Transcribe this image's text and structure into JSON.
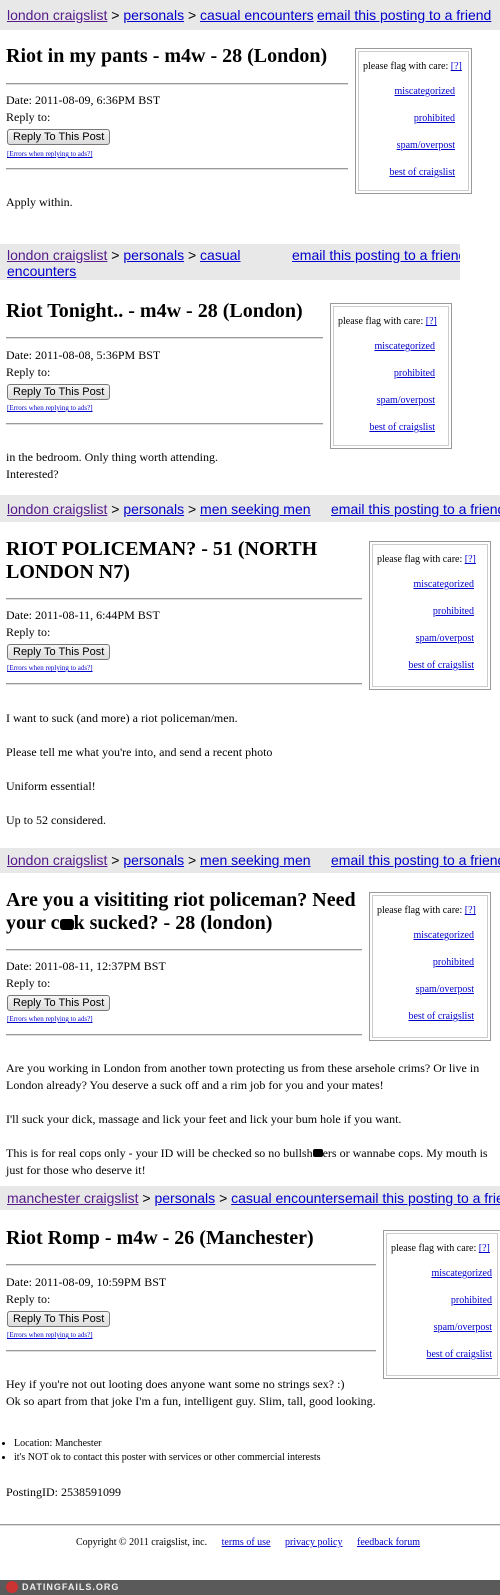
{
  "posts": [
    {
      "crumbs": {
        "city": "london craigslist",
        "section": "personals",
        "category": "casual encounters"
      },
      "email": "email this posting to a friend",
      "title": "Riot in my pants - m4w - 28 (London)",
      "date": "Date: 2011-08-09, 6:36PM BST",
      "reply_to": "Reply to:",
      "reply_button": "Reply To This Post",
      "errors_link": "[Errors when replying to ads?]",
      "body": [
        "Apply within."
      ]
    },
    {
      "crumbs": {
        "city": "london craigslist",
        "section": "personals",
        "category": "casual",
        "category_cont": "encounters"
      },
      "email": "email this posting to a friend",
      "title": "Riot Tonight.. - m4w - 28 (London)",
      "date": "Date: 2011-08-08, 5:36PM BST",
      "reply_to": "Reply to:",
      "reply_button": "Reply To This Post",
      "errors_link": "[Errors when replying to ads?]",
      "body": [
        "in the bedroom. Only thing worth attending.",
        "Interested?"
      ]
    },
    {
      "crumbs": {
        "city": "london craigslist",
        "section": "personals",
        "category": "men seeking men"
      },
      "email": "email this posting to a friend",
      "title_line1": "RIOT POLICEMAN? - 51 (NORTH",
      "title_line2": "LONDON N7)",
      "date": "Date: 2011-08-11, 6:44PM BST",
      "reply_to": "Reply to:",
      "reply_button": "Reply To This Post",
      "errors_link": "[Errors when replying to ads?]",
      "body": [
        "I want to suck (and more) a riot policeman/men.",
        "Please tell me what you're into, and send a recent photo",
        "Uniform essential!",
        "Up to 52 considered."
      ]
    },
    {
      "crumbs": {
        "city": "london craigslist",
        "section": "personals",
        "category": "men seeking men"
      },
      "email": "email this posting to a friend",
      "title_line1": "Are you a visititing riot policeman? Need",
      "title_line2_a": "your c",
      "title_line2_b": "k sucked? - 28 (london)",
      "date": "Date: 2011-08-11, 12:37PM BST",
      "reply_to": "Reply to:",
      "reply_button": "Reply To This Post",
      "errors_link": "[Errors when replying to ads?]",
      "body_1": "Are you working in London from another town protecting us from these arsehole crims? Or live in London already? You deserve a suck off and a rim job for you and your mates!",
      "body_2": "I'll suck your dick, massage and lick your feet and lick your bum hole if you want.",
      "body_3a": "This is for real cops only - your ID will be checked so no bullsh",
      "body_3b": "ers or wannabe cops. My mouth is just for those who deserve it!"
    },
    {
      "crumbs": {
        "city": "manchester craigslist",
        "section": "personals",
        "category": "casual encounters"
      },
      "email": "email this posting to a friend",
      "title": "Riot Romp - m4w - 26 (Manchester)",
      "date": "Date: 2011-08-09, 10:59PM BST",
      "reply_to": "Reply to:",
      "reply_button": "Reply To This Post",
      "errors_link": "[Errors when replying to ads?]",
      "body": [
        "Hey if you're not out looting does anyone want some no strings sex? :)",
        "Ok so apart from that joke I'm a fun, intelligent guy. Slim, tall, good looking."
      ],
      "info": [
        "Location: Manchester",
        "it's NOT ok to contact this poster with services or other commercial interests"
      ],
      "posting_id": "PostingID: 2538591099"
    }
  ],
  "flag": {
    "heading": "please flag with care:",
    "help": "[?]",
    "options": [
      "miscategorized",
      "prohibited",
      "spam/overpost",
      "best of craigslist"
    ]
  },
  "footer": {
    "copyright": "Copyright © 2011 craigslist, inc.",
    "terms": "terms of use",
    "privacy": "privacy policy",
    "feedback": "feedback forum"
  },
  "watermark": "DATINGFAILS.ORG",
  "colors": {
    "link": "#0000cc",
    "visited": "#551a8b",
    "nav_bg": "#e8e8e8"
  }
}
